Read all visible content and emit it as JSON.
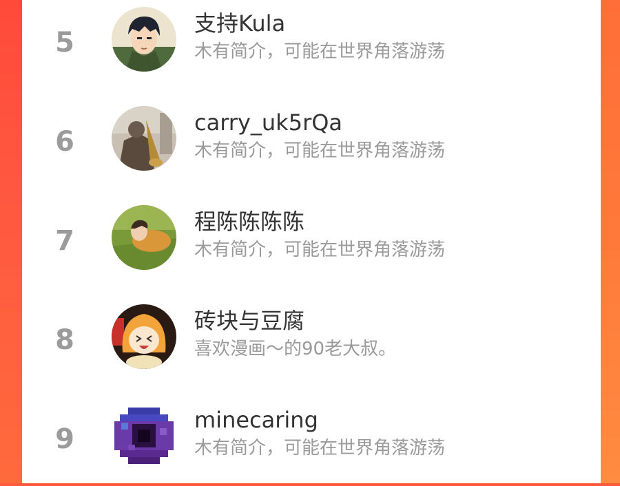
{
  "users": [
    {
      "rank": "5",
      "name": "支持Kula",
      "bio": "木有简介，可能在世界角落游荡",
      "avatar_icon": "anime-man-avatar"
    },
    {
      "rank": "6",
      "name": "carry_uk5rQa",
      "bio": "木有简介，可能在世界角落游荡",
      "avatar_icon": "saxophone-photo-avatar"
    },
    {
      "rank": "7",
      "name": "程陈陈陈陈",
      "bio": "木有简介，可能在世界角落游荡",
      "avatar_icon": "person-on-grass-avatar"
    },
    {
      "rank": "8",
      "name": "砖块与豆腐",
      "bio": "喜欢漫画～的90老大叔。",
      "avatar_icon": "anime-girl-avatar"
    },
    {
      "rank": "9",
      "name": "minecaring",
      "bio": "木有简介，可能在世界角落游荡",
      "avatar_icon": "pixel-ender-pearl-avatar"
    }
  ],
  "colors": {
    "background_accent": "#ff6b3a",
    "rank": "#9b9b9b",
    "name": "#333333",
    "bio": "#9a9a9a"
  }
}
